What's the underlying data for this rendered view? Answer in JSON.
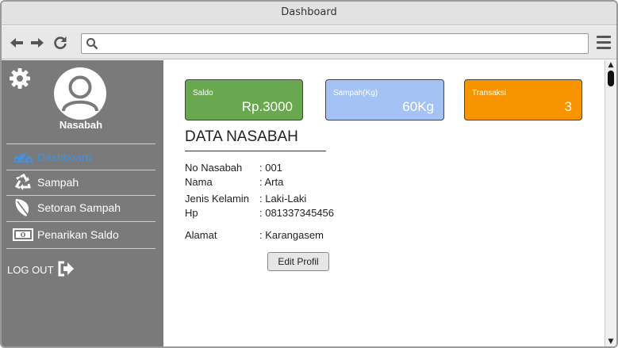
{
  "window": {
    "title": "Dashboard"
  },
  "browser": {
    "url_value": "",
    "url_placeholder": ""
  },
  "sidebar": {
    "user_name": "Nasabah",
    "items": [
      {
        "label": "Dashboard",
        "icon": "dashboard-gauge-icon",
        "active": true
      },
      {
        "label": "Sampah",
        "icon": "recycle-icon",
        "active": false
      },
      {
        "label": "Setoran Sampah",
        "icon": "leaf-icon",
        "active": false
      },
      {
        "label": "Penarikan Saldo",
        "icon": "money-bill-icon",
        "active": false
      }
    ],
    "logout_label": "LOG OUT"
  },
  "cards": [
    {
      "label": "Saldo",
      "value": "Rp.3000",
      "color": "#6aa84f"
    },
    {
      "label": "Sampah(Kg)",
      "value": "60Kg",
      "color": "#a4c2f4"
    },
    {
      "label": "Transaksi",
      "value": "3",
      "color": "#f79400"
    }
  ],
  "profile": {
    "title": "DATA NASABAH",
    "fields": [
      {
        "key": "No Nasabah",
        "value": ": 001"
      },
      {
        "key": "Nama",
        "value": ": Arta"
      },
      {
        "key": "Jenis Kelamin",
        "value": ": Laki-Laki"
      },
      {
        "key": "Hp",
        "value": ": 081337345456"
      },
      {
        "key": "Alamat",
        "value": ": Karangasem"
      }
    ],
    "edit_label": "Edit Profil"
  }
}
